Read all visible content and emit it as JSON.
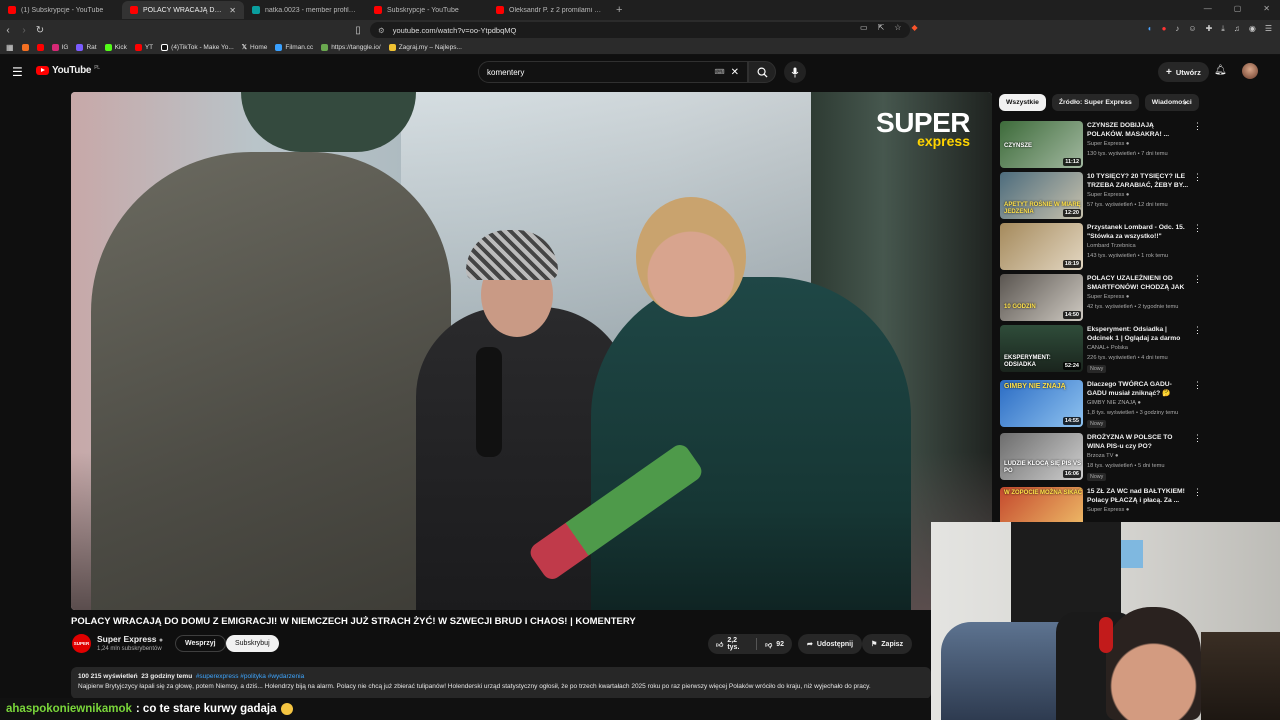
{
  "browser": {
    "tabs": [
      {
        "title": "(1) Subskrypcje - YouTube",
        "icon": "youtube-icon",
        "active": false
      },
      {
        "title": "POLACY WRACAJĄ DO DOM",
        "icon": "youtube-icon",
        "active": true
      },
      {
        "title": "natka.0023 - member profile | Vinted",
        "icon": "vinted-icon",
        "active": false
      },
      {
        "title": "Subskrypcje - YouTube",
        "icon": "youtube-icon",
        "active": false
      },
      {
        "title": "Oleksandr P. z 2 promilami wjechał w",
        "icon": "youtube-icon",
        "active": false
      }
    ],
    "url": "youtube.com/watch?v=oo-YtpdbqMQ",
    "bookmarks": [
      {
        "label": "IG",
        "color": "#d62976"
      },
      {
        "label": "Rat",
        "color": "#7b5cff"
      },
      {
        "label": "Kick",
        "color": "#53fc18"
      },
      {
        "label": "YT",
        "color": "#ff0000"
      },
      {
        "label": "(4)TikTok - Make Yo...",
        "color": "#ffffff"
      },
      {
        "label": "Home",
        "color": "#ffffff"
      },
      {
        "label": "Filman.cc",
        "color": "#39a0ff"
      },
      {
        "label": "https://tanggle.io/",
        "color": "#6aa84f"
      },
      {
        "label": "Zagraj.my – Najleps...",
        "color": "#f1c232"
      }
    ]
  },
  "masthead": {
    "logo": "YouTube",
    "country": "PL",
    "search_value": "komentery",
    "create_label": "Utwórz"
  },
  "video": {
    "watermark_line1": "SUPER",
    "watermark_line2": "express",
    "title": "POLACY WRACAJĄ DO DOMU Z EMIGRACJI! W NIEMCZECH JUŻ STRACH ŻYĆ! W SZWECJI BRUD I CHAOS! | KOMENTERY",
    "channel": "Super Express",
    "channel_avatar_text": "SUPER",
    "subscribers": "1,24 mln subskrybentów",
    "join_label": "Wesprzyj",
    "subscribe_label": "Subskrybuj",
    "likes": "2,2 tys.",
    "dislikes": "92",
    "share_label": "Udostępnij",
    "save_label": "Zapisz",
    "views": "100 215 wyświetleń",
    "age": "23 godziny temu",
    "tags": "#superexpress #polityka #wydarzenia",
    "description": "Najpierw Brytyjczycy łapali się za głowę, potem Niemcy, a dziś... Holendrzy biją na alarm. Polacy nie chcą już zbierać tulipanów! Holenderski urząd statystyczny ogłosił, że po trzech kwartałach 2025 roku po raz pierwszy więcej Polaków wróciło do kraju, niż wyjechało do pracy."
  },
  "chips": [
    {
      "label": "Wszystkie",
      "active": true
    },
    {
      "label": "Źródło: Super Express",
      "active": false
    },
    {
      "label": "Wiadomości",
      "active": false
    }
  ],
  "recommendations": [
    {
      "title": "CZYNSZE DOBIJAJĄ POLAKÓW. MASAKRA! ...",
      "channel": "Super Express",
      "meta": "130 tys. wyświetleń • 7 dni temu",
      "duration": "11:12",
      "badge": "",
      "thumb_text": "CZYNSZE",
      "thumb_color": "#3d6b3a"
    },
    {
      "title": "10 TYSIĘCY? 20 TYSIĘCY? ILE TRZEBA ZARABIAĆ, ŻEBY BY...",
      "channel": "Super Express",
      "meta": "57 tys. wyświetleń • 12 dni temu",
      "duration": "12:20",
      "badge": "",
      "thumb_text": "APETYT ROŚNIE W MIARĘ JEDZENIA",
      "thumb_color": "#4d6c7d"
    },
    {
      "title": "Przystanek Lombard - Odc. 15. \"Stówka za wszystko!!\"",
      "channel": "Lombard Trzebnica",
      "meta": "143 tys. wyświetleń • 1 rok temu",
      "duration": "18:19",
      "badge": "",
      "thumb_text": "",
      "thumb_color": "#a58a5c"
    },
    {
      "title": "POLACY UZALEŻNIENI OD SMARTFONÓW! CHODZĄ JAK ...",
      "channel": "Super Express",
      "meta": "42 tys. wyświetleń • 2 tygodnie temu",
      "duration": "14:50",
      "badge": "",
      "thumb_text": "10 GODZIN",
      "thumb_color": "#5a5550"
    },
    {
      "title": "Eksperyment: Odsiadka | Odcinek 1 | Oglądaj za darmo",
      "channel": "CANAL+ Polska",
      "meta": "226 tys. wyświetleń • 4 dni temu",
      "duration": "52:24",
      "badge": "Nowy",
      "thumb_text": "EKSPERYMENT: ODSIADKA",
      "thumb_color": "#2f4d3a"
    },
    {
      "title": "Dlaczego TWÓRCA GADU-GADU musiał zniknąć? 🤔 Historia ...",
      "channel": "GIMBY NIE ZNAJĄ",
      "meta": "1,8 tys. wyświetleń • 3 godziny temu",
      "duration": "14:55",
      "badge": "Nowy",
      "thumb_text": "GIMBY NIE ZNAJĄ",
      "thumb_color": "#2b6cc4"
    },
    {
      "title": "DROŻYZNA W POLSCE TO WINA PIS-u czy PO?",
      "channel": "Brzoza TV",
      "meta": "18 tys. wyświetleń • 5 dni temu",
      "duration": "16:06",
      "badge": "Nowy",
      "thumb_text": "LUDZIE KLOCĄ SIĘ PIS VS PO",
      "thumb_color": "#6d6d6d"
    },
    {
      "title": "15 ZŁ ZA WC nad BAŁTYKIEM! Polacy PŁACZĄ i płacą. Za ...",
      "channel": "Super Express",
      "meta": "",
      "duration": "",
      "badge": "",
      "thumb_text": "W ZOPOCIE MOŻNA SIKAĆ",
      "thumb_color": "#c4492d"
    }
  ],
  "chat": {
    "user": "ahaspokoniewnikamok",
    "message": ": co te stare kurwy gadaja"
  }
}
